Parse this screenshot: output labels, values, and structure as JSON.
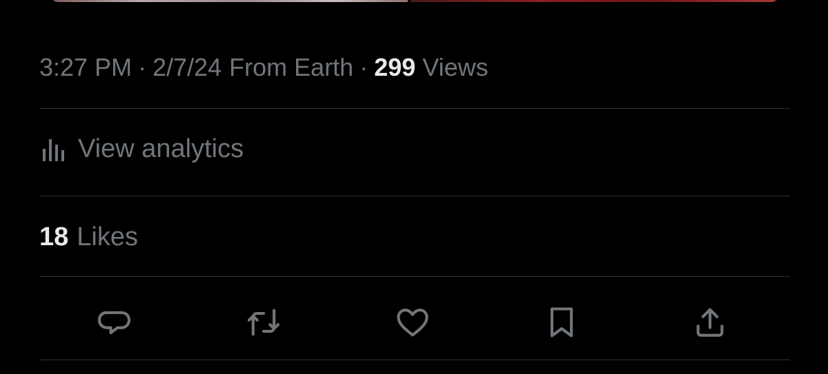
{
  "media": {
    "left_color": "#9e8d8d",
    "right_color": "#8b2020"
  },
  "meta": {
    "time": "3:27 PM",
    "separator": "·",
    "date": "2/7/24",
    "source": "From Earth",
    "views_count": "299",
    "views_label": "Views"
  },
  "analytics": {
    "icon": "bar-chart-icon",
    "label": "View analytics"
  },
  "likes": {
    "count": "18",
    "label": "Likes"
  },
  "actions": [
    {
      "icon": "reply-icon"
    },
    {
      "icon": "retweet-icon"
    },
    {
      "icon": "like-icon"
    },
    {
      "icon": "bookmark-icon"
    },
    {
      "icon": "share-icon"
    }
  ],
  "colors": {
    "background": "#000000",
    "text_secondary": "#71767b",
    "text_primary": "#e7e9ea",
    "divider": "#2f3336"
  }
}
